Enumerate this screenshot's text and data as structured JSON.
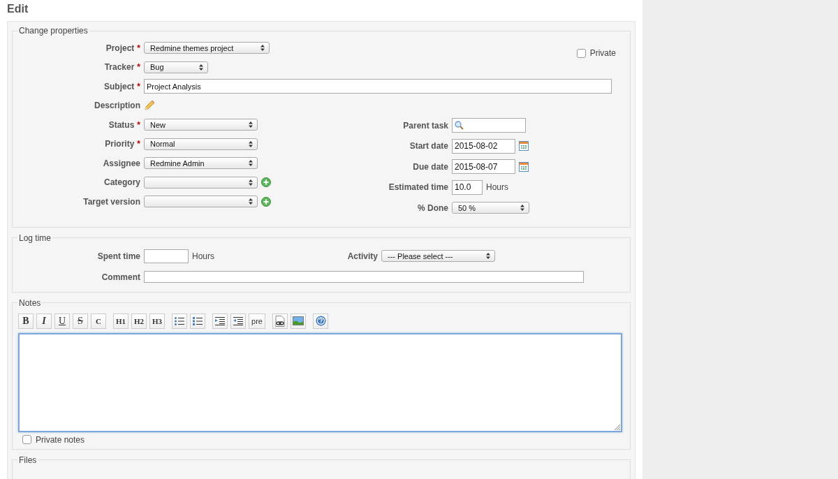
{
  "heading": "Edit",
  "properties": {
    "legend": "Change properties",
    "private": {
      "label": "Private",
      "checked": false
    },
    "top_fields": [
      {
        "label": "Project",
        "required_mark": "*",
        "kind": "select",
        "value": "Redmine themes project"
      },
      {
        "label": "Tracker",
        "required_mark": "*",
        "kind": "select",
        "value": "Bug"
      },
      {
        "label": "Subject",
        "required_mark": "*",
        "kind": "text",
        "value": "Project Analysis"
      },
      {
        "label": "Description",
        "kind": "edit"
      }
    ],
    "left_fields": [
      {
        "label": "Status",
        "required_mark": "*",
        "value": "New"
      },
      {
        "label": "Priority",
        "required_mark": "*",
        "value": "Normal"
      },
      {
        "label": "Assignee",
        "value": "Redmine Admin"
      },
      {
        "label": "Category",
        "add": true
      },
      {
        "label": "Target version",
        "add": true
      }
    ],
    "right_fields": [
      {
        "label": "Parent task",
        "kind": "search"
      },
      {
        "label": "Start date",
        "kind": "date",
        "value": "2015-08-02"
      },
      {
        "label": "Due date",
        "kind": "date",
        "value": "2015-08-07"
      },
      {
        "label": "Estimated time",
        "kind": "hours",
        "value": "10.0",
        "unit": "Hours"
      },
      {
        "label": "% Done",
        "kind": "select",
        "value": "50 %"
      }
    ]
  },
  "log_time": {
    "legend": "Log time",
    "spent_label": "Spent time",
    "spent_unit": "Hours",
    "activity_label": "Activity",
    "activity_value": "--- Please select ---",
    "comment_label": "Comment"
  },
  "notes": {
    "legend": "Notes",
    "toolbar": [
      [
        {
          "kind": "bold",
          "label": "B"
        },
        {
          "kind": "italic",
          "label": "I"
        },
        {
          "kind": "underline",
          "label": "U"
        },
        {
          "kind": "strike",
          "label": "S"
        },
        {
          "kind": "text",
          "label": "C"
        }
      ],
      [
        {
          "kind": "text",
          "label": "H1"
        },
        {
          "kind": "text",
          "label": "H2"
        },
        {
          "kind": "text",
          "label": "H3"
        }
      ],
      [
        {
          "kind": "bullets"
        },
        {
          "kind": "numbers"
        }
      ],
      [
        {
          "kind": "indent"
        },
        {
          "kind": "outdent"
        },
        {
          "kind": "mono",
          "label": "pre"
        }
      ],
      [
        {
          "kind": "link"
        },
        {
          "kind": "image"
        }
      ],
      [
        {
          "kind": "help"
        }
      ]
    ],
    "private_notes": {
      "label": "Private notes",
      "checked": false
    }
  },
  "files": {
    "legend": "Files"
  }
}
